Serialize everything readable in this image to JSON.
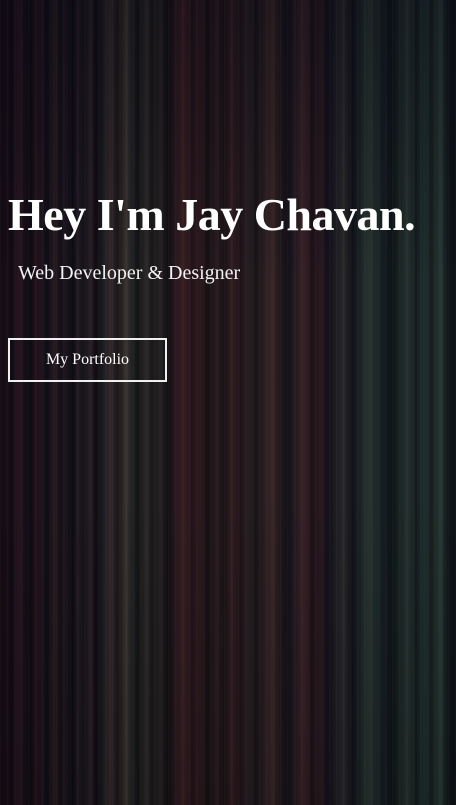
{
  "hero": {
    "title": "Hey I'm Jay Chavan.",
    "subtitle": "Web Developer & Designer",
    "cta_label": "My Portfolio"
  },
  "colors": {
    "text": "#ffffff",
    "button_border": "#f0f0f0",
    "background_dark": "#0b0911"
  }
}
